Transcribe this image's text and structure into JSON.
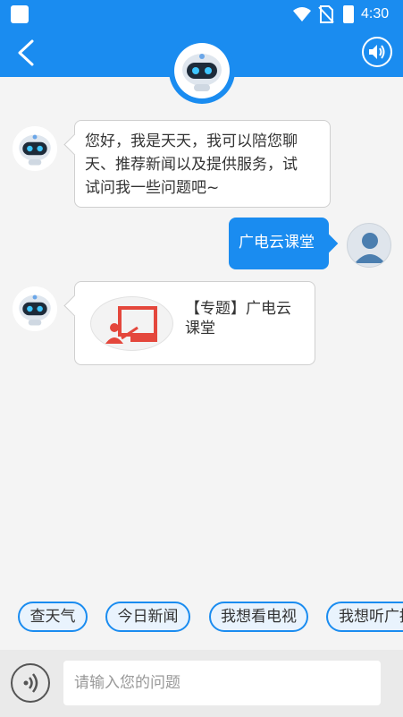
{
  "status_bar": {
    "time": "4:30"
  },
  "header": {
    "back_icon": "chevron-left-icon",
    "sound_icon": "speaker-icon",
    "bot_avatar": "robot-avatar"
  },
  "messages": [
    {
      "from": "bot",
      "text_lines": [
        "您好，我是天天，我可以陪您聊",
        "天、推荐新闻以及提供服务，试",
        "试问我一些问题吧~"
      ]
    },
    {
      "from": "user",
      "text": "广电云课堂"
    },
    {
      "from": "bot",
      "card": {
        "title_lines": [
          "【专题】广电云",
          "课堂"
        ],
        "icon": "classroom-board-icon"
      }
    }
  ],
  "quick_replies": [
    "查天气",
    "今日新闻",
    "我想看电视",
    "我想听广播"
  ],
  "input": {
    "placeholder": "请输入您的问题",
    "value": ""
  },
  "colors": {
    "primary": "#1a8cf0",
    "card_icon": "#e4473c"
  }
}
